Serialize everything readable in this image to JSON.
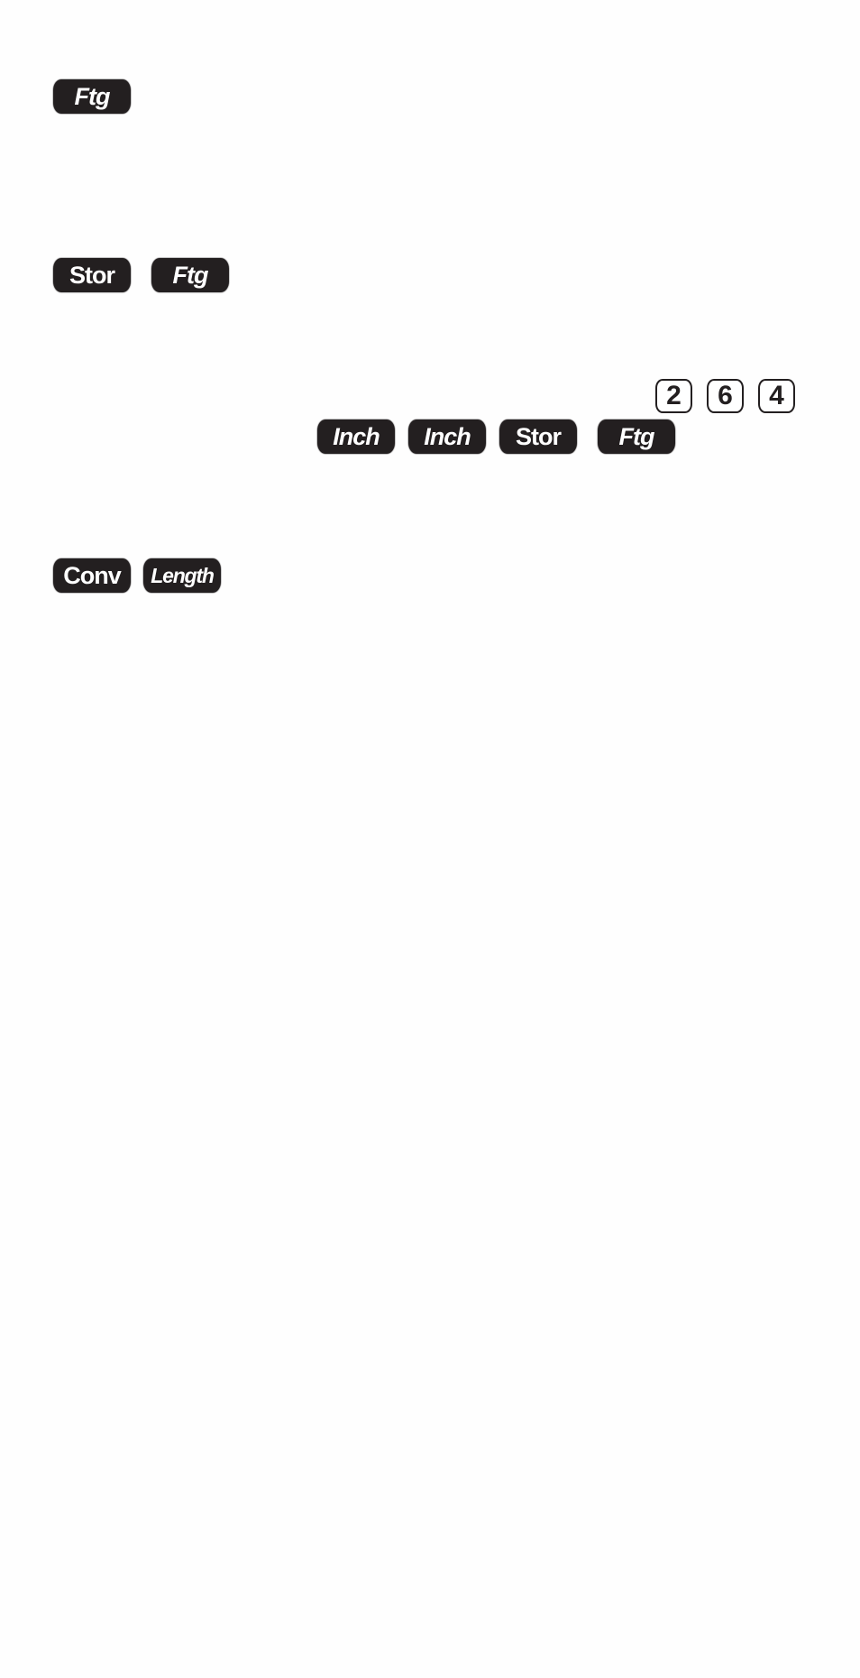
{
  "document": {
    "type": "calculator keystroke instructions",
    "colors": {
      "key_background": "#231f20",
      "key_text": "#ffffff",
      "page_background": "#fefefe"
    }
  },
  "sequences": [
    {
      "keys": [
        {
          "label": "Ftg",
          "style": "italic"
        }
      ]
    },
    {
      "keys": [
        {
          "label": "Stor",
          "style": "normal"
        },
        {
          "label": "Ftg",
          "style": "italic"
        }
      ]
    },
    {
      "number_keys": [
        "2",
        "6",
        "4"
      ],
      "keys": [
        {
          "label": "Inch",
          "style": "italic"
        },
        {
          "label": "Inch",
          "style": "italic"
        },
        {
          "label": "Stor",
          "style": "normal"
        },
        {
          "label": "Ftg",
          "style": "italic"
        }
      ]
    },
    {
      "keys": [
        {
          "label": "Conv",
          "style": "normal"
        },
        {
          "label": "Length",
          "style": "italic"
        }
      ]
    }
  ]
}
